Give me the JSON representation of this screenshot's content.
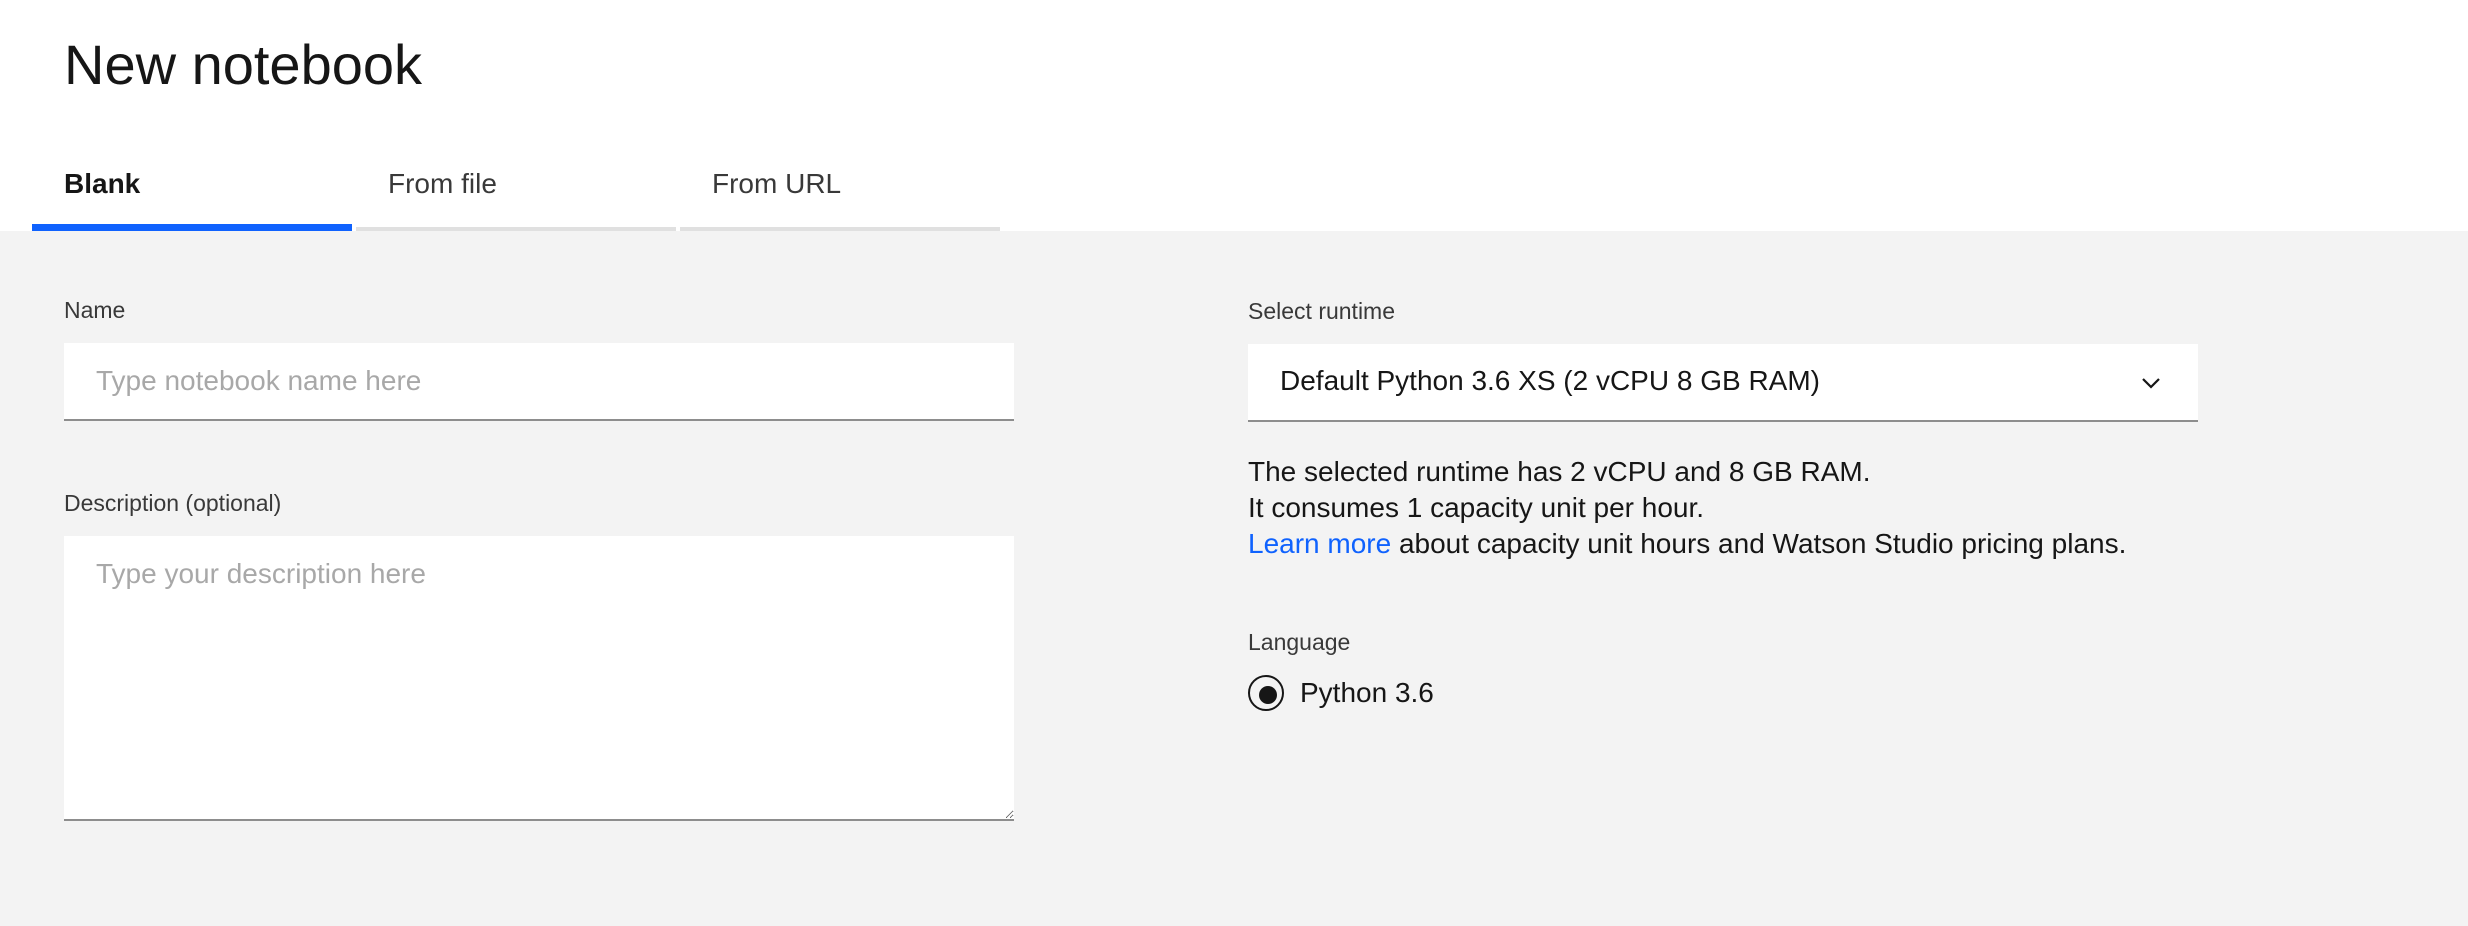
{
  "page": {
    "title": "New notebook"
  },
  "tabs": [
    {
      "label": "Blank",
      "active": true
    },
    {
      "label": "From file",
      "active": false
    },
    {
      "label": "From URL",
      "active": false
    }
  ],
  "form": {
    "name": {
      "label": "Name",
      "value": "",
      "placeholder": "Type notebook name here"
    },
    "description": {
      "label": "Description (optional)",
      "value": "",
      "placeholder": "Type your description here"
    },
    "runtime": {
      "label": "Select runtime",
      "selected": "Default Python 3.6 XS (2 vCPU 8 GB RAM)",
      "info_line1": "The selected runtime has 2 vCPU and 8 GB RAM.",
      "info_line2": "It consumes 1 capacity unit per hour.",
      "learn_more_link": "Learn more",
      "info_line3_rest": " about capacity unit hours and Watson Studio pricing plans."
    },
    "language": {
      "label": "Language",
      "options": [
        {
          "label": "Python 3.6",
          "selected": true
        }
      ]
    }
  },
  "colors": {
    "accent": "#0f62fe",
    "background": "#f3f3f3",
    "text": "#161616"
  },
  "icons": {
    "select_chevron": "chevron-down-icon",
    "textarea_resize": "resize-handle-icon"
  }
}
